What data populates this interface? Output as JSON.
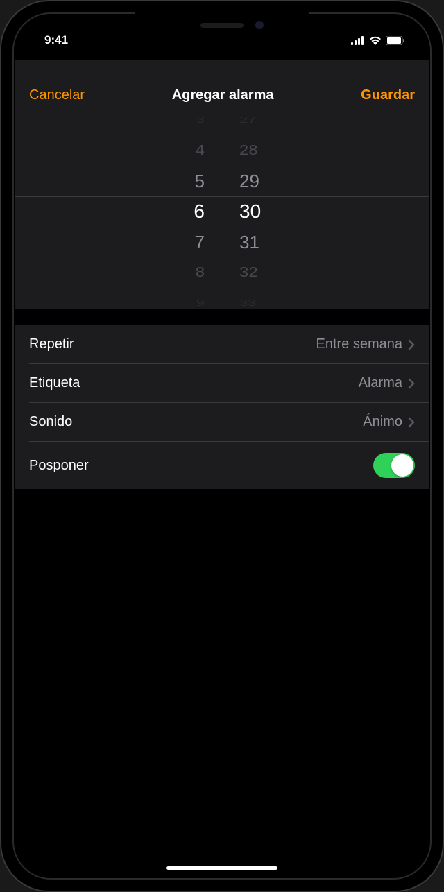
{
  "statusBar": {
    "time": "9:41"
  },
  "nav": {
    "cancel": "Cancelar",
    "title": "Agregar alarma",
    "save": "Guardar"
  },
  "picker": {
    "hours": [
      "3",
      "4",
      "5",
      "6",
      "7",
      "8",
      "9"
    ],
    "minutes": [
      "27",
      "28",
      "29",
      "30",
      "31",
      "32",
      "33"
    ],
    "selectedHour": "6",
    "selectedMinute": "30"
  },
  "settings": {
    "repeat": {
      "label": "Repetir",
      "value": "Entre semana"
    },
    "label": {
      "label": "Etiqueta",
      "value": "Alarma"
    },
    "sound": {
      "label": "Sonido",
      "value": "Ánimo"
    },
    "snooze": {
      "label": "Posponer",
      "on": true
    }
  }
}
